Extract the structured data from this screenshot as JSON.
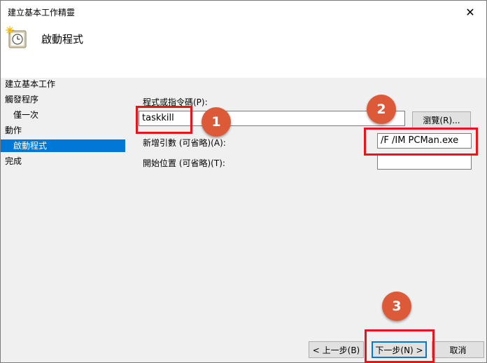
{
  "window": {
    "title": "建立基本工作精靈",
    "close_glyph": "✕"
  },
  "header": {
    "title": "啟動程式",
    "icon": "clock-icon"
  },
  "sidebar": {
    "items": [
      {
        "label": "建立基本工作"
      },
      {
        "label": "觸發程序"
      },
      {
        "label": "僅一次"
      },
      {
        "label": "動作"
      },
      {
        "label": "啟動程式"
      },
      {
        "label": "完成"
      }
    ],
    "selected_index": 4
  },
  "form": {
    "program_label": "程式或指令碼(P):",
    "program_value": "taskkill",
    "browse_label": "瀏覽(R)...",
    "args_label": "新增引數 (可省略)(A):",
    "args_value": "/F /IM PCMan.exe",
    "start_in_label": "開始位置 (可省略)(T):",
    "start_in_value": ""
  },
  "footer": {
    "back_label": "< 上一步(B)",
    "next_label": "下一步(N) >",
    "cancel_label": "取消"
  },
  "annotations": {
    "badges": [
      "1",
      "2",
      "3"
    ],
    "highlight_color": "#e8141c",
    "badge_color": "#dd5a39"
  },
  "colors": {
    "selection": "#0078d7"
  }
}
